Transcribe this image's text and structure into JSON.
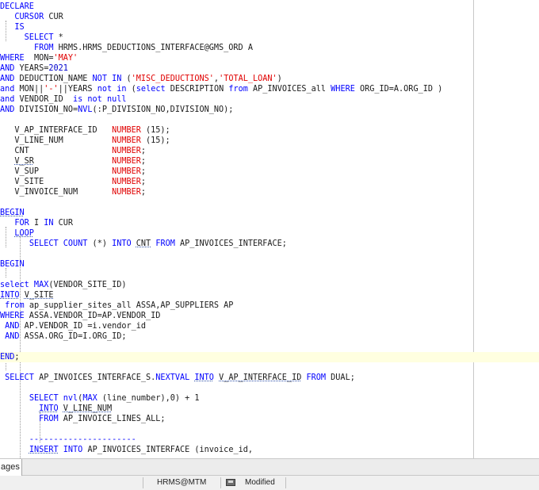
{
  "editor": {
    "lines": [
      [
        {
          "t": "DECLARE",
          "c": "kw"
        }
      ],
      [
        {
          "t": "   "
        },
        {
          "t": "CURSOR",
          "c": "kw"
        },
        {
          "t": " CUR"
        }
      ],
      [
        {
          "t": "   "
        },
        {
          "t": "IS",
          "c": "kw"
        }
      ],
      [
        {
          "t": "     "
        },
        {
          "t": "SELECT",
          "c": "kw"
        },
        {
          "t": " *"
        }
      ],
      [
        {
          "t": "       "
        },
        {
          "t": "FROM",
          "c": "kw"
        },
        {
          "t": " HRMS.HRMS_DEDUCTIONS_INTERFACE@GMS_ORD A"
        }
      ],
      [
        {
          "t": "WHERE",
          "c": "kw"
        },
        {
          "t": "  MON="
        },
        {
          "t": "'MAY'",
          "c": "str"
        }
      ],
      [
        {
          "t": "AND",
          "c": "kw"
        },
        {
          "t": " YEARS="
        },
        {
          "t": "2021",
          "c": "num"
        }
      ],
      [
        {
          "t": "AND",
          "c": "kw"
        },
        {
          "t": " DEDUCTION_NAME "
        },
        {
          "t": "NOT IN",
          "c": "kw"
        },
        {
          "t": " ("
        },
        {
          "t": "'MISC_DEDUCTIONS'",
          "c": "str"
        },
        {
          "t": ","
        },
        {
          "t": "'TOTAL_LOAN'",
          "c": "str"
        },
        {
          "t": ")"
        }
      ],
      [
        {
          "t": "and",
          "c": "kw"
        },
        {
          "t": " MON||"
        },
        {
          "t": "'-'",
          "c": "str"
        },
        {
          "t": "||YEARS "
        },
        {
          "t": "not in",
          "c": "kw"
        },
        {
          "t": " ("
        },
        {
          "t": "select",
          "c": "kw"
        },
        {
          "t": " DESCRIPTION "
        },
        {
          "t": "from",
          "c": "kw"
        },
        {
          "t": " AP_INVOICES_all "
        },
        {
          "t": "WHERE",
          "c": "kw"
        },
        {
          "t": " ORG_ID=A.ORG_ID )"
        }
      ],
      [
        {
          "t": "and",
          "c": "kw"
        },
        {
          "t": " VENDOR_ID  "
        },
        {
          "t": "is not null",
          "c": "kw"
        }
      ],
      [
        {
          "t": "AND",
          "c": "kw"
        },
        {
          "t": " DIVISION_NO="
        },
        {
          "t": "NVL",
          "c": "kw"
        },
        {
          "t": "(:P_DIVISION_NO,DIVISION_NO);"
        }
      ],
      [],
      [
        {
          "t": "   V_AP_INTERFACE_ID   "
        },
        {
          "t": "NUMBER",
          "c": "type"
        },
        {
          "t": " (15);"
        }
      ],
      [
        {
          "t": "   V_LINE_NUM          "
        },
        {
          "t": "NUMBER",
          "c": "type"
        },
        {
          "t": " (15);"
        }
      ],
      [
        {
          "t": "   CNT                 "
        },
        {
          "t": "NUMBER",
          "c": "type"
        },
        {
          "t": ";"
        }
      ],
      [
        {
          "t": "   "
        },
        {
          "t": "V_SR",
          "c": "sq"
        },
        {
          "t": "                "
        },
        {
          "t": "NUMBER",
          "c": "type"
        },
        {
          "t": ";"
        }
      ],
      [
        {
          "t": "   V_SUP               "
        },
        {
          "t": "NUMBER",
          "c": "type"
        },
        {
          "t": ";"
        }
      ],
      [
        {
          "t": "   V_SITE              "
        },
        {
          "t": "NUMBER",
          "c": "type"
        },
        {
          "t": ";"
        }
      ],
      [
        {
          "t": "   V_INVOICE_NUM       "
        },
        {
          "t": "NUMBER",
          "c": "type"
        },
        {
          "t": ";"
        }
      ],
      [],
      [
        {
          "t": "BEGIN",
          "c": "kw sq"
        }
      ],
      [
        {
          "t": "   "
        },
        {
          "t": "FOR",
          "c": "kw"
        },
        {
          "t": " I "
        },
        {
          "t": "IN",
          "c": "kw"
        },
        {
          "t": " CUR"
        }
      ],
      [
        {
          "t": "   "
        },
        {
          "t": "LOOP",
          "c": "kw sq"
        }
      ],
      [
        {
          "t": "      "
        },
        {
          "t": "SELECT COUNT",
          "c": "kw"
        },
        {
          "t": " (*) "
        },
        {
          "t": "INTO",
          "c": "kw"
        },
        {
          "t": " "
        },
        {
          "t": "CNT",
          "c": "sq"
        },
        {
          "t": " "
        },
        {
          "t": "FROM",
          "c": "kw"
        },
        {
          "t": " AP_INVOICES_INTERFACE;"
        }
      ],
      [],
      [
        {
          "t": "BEGIN",
          "c": "kw"
        }
      ],
      [],
      [
        {
          "t": "select MAX",
          "c": "kw"
        },
        {
          "t": "(VENDOR_SITE_ID)"
        }
      ],
      [
        {
          "t": "INTO",
          "c": "kw sq"
        },
        {
          "t": " "
        },
        {
          "t": "V_SITE",
          "c": "sq"
        }
      ],
      [
        {
          "t": " "
        },
        {
          "t": "from",
          "c": "kw"
        },
        {
          "t": " ap_supplier_sites_all ASSA,AP_SUPPLIERS AP"
        }
      ],
      [
        {
          "t": "WHERE",
          "c": "kw"
        },
        {
          "t": " ASSA.VENDOR_ID=AP.VENDOR_ID"
        }
      ],
      [
        {
          "t": " "
        },
        {
          "t": "AND",
          "c": "kw"
        },
        {
          "t": " AP.VENDOR_ID =i.vendor_id"
        }
      ],
      [
        {
          "t": " "
        },
        {
          "t": "AND",
          "c": "kw"
        },
        {
          "t": " ASSA.ORG_ID=I.ORG_ID;"
        }
      ],
      [],
      [
        {
          "t": "END",
          "c": "kw"
        },
        {
          "t": ";"
        }
      ],
      [],
      [
        {
          "t": " "
        },
        {
          "t": "SELECT",
          "c": "kw"
        },
        {
          "t": " AP_INVOICES_INTERFACE_S."
        },
        {
          "t": "NEXTVAL",
          "c": "kw"
        },
        {
          "t": " "
        },
        {
          "t": "INTO",
          "c": "kw sq"
        },
        {
          "t": " "
        },
        {
          "t": "V_AP_INTERFACE_ID",
          "c": "sq"
        },
        {
          "t": " "
        },
        {
          "t": "FROM",
          "c": "kw"
        },
        {
          "t": " DUAL;"
        }
      ],
      [],
      [
        {
          "t": "      "
        },
        {
          "t": "SELECT",
          "c": "kw"
        },
        {
          "t": " "
        },
        {
          "t": "nvl",
          "c": "kw"
        },
        {
          "t": "("
        },
        {
          "t": "MAX",
          "c": "kw"
        },
        {
          "t": " (line_number),0) + 1"
        }
      ],
      [
        {
          "t": "        "
        },
        {
          "t": "INTO",
          "c": "kw sq"
        },
        {
          "t": " "
        },
        {
          "t": "V_LINE_NUM",
          "c": "sq"
        }
      ],
      [
        {
          "t": "        "
        },
        {
          "t": "FROM",
          "c": "kw"
        },
        {
          "t": " AP_INVOICE_LINES_ALL;"
        }
      ],
      [],
      [
        {
          "t": "      ----------------------",
          "c": "kw"
        }
      ],
      [
        {
          "t": "      "
        },
        {
          "t": "INSERT",
          "c": "kw sq"
        },
        {
          "t": " "
        },
        {
          "t": "INTO",
          "c": "kw"
        },
        {
          "t": " AP_INVOICES_INTERFACE (invoice_id,"
        }
      ]
    ],
    "current_line": 34
  },
  "tabbar": {
    "tab_label": "ages"
  },
  "statusbar": {
    "connection": "HRMS@MTM",
    "state": "Modified"
  },
  "icons": {
    "save_state": "disk-icon"
  }
}
